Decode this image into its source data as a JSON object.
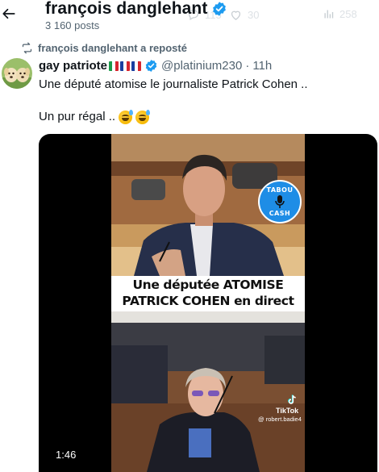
{
  "header": {
    "back_icon": "arrow-left-icon",
    "title": "françois danglehant",
    "post_count": "3 160 posts",
    "faded_actions": [
      {
        "icon": "reply-icon",
        "count": "115"
      },
      {
        "icon": "heart-icon",
        "count": "30"
      },
      {
        "icon": "views-icon",
        "count": "258"
      }
    ]
  },
  "repost": {
    "icon": "repost-icon",
    "text": "françois danglehant a reposté"
  },
  "tweet": {
    "author_name": "gay patriote",
    "flags": [
      "italy-flag",
      "france-flag",
      "france-flag"
    ],
    "handle": "@platinium230",
    "separator": "·",
    "time": "11h",
    "text_line1": "Une député atomise le journaliste Patrick Cohen ..",
    "text_line2": "Un pur régal ..",
    "emojis": [
      "sweat-smile-emoji",
      "sweat-smile-emoji"
    ]
  },
  "video": {
    "caption_line1": "Une députée ATOMISE",
    "caption_line2": "PATRICK COHEN en direct",
    "badge_top": "TABOU",
    "badge_bottom": "CASH",
    "tiktok_label": "TikTok",
    "tiktok_user": "@ robert.badie4",
    "duration": "1:46"
  },
  "colors": {
    "text_primary": "#0f1419",
    "text_secondary": "#536471",
    "verified_blue": "#1d9bf0",
    "badge_blue": "#1e8de6"
  }
}
